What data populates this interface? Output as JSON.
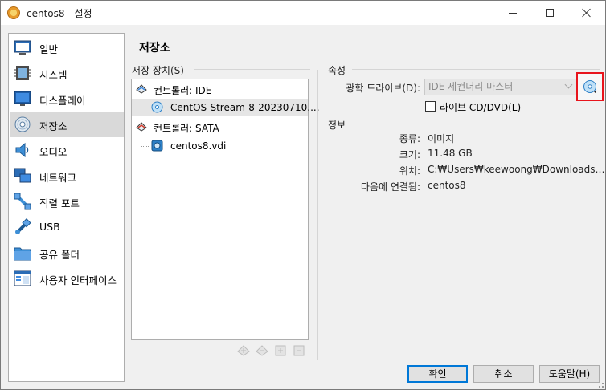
{
  "window": {
    "title": "centos8 - 설정"
  },
  "sidebar": {
    "items": [
      {
        "label": "일반",
        "icon": "general-icon"
      },
      {
        "label": "시스템",
        "icon": "system-icon"
      },
      {
        "label": "디스플레이",
        "icon": "display-icon"
      },
      {
        "label": "저장소",
        "icon": "storage-icon",
        "selected": true
      },
      {
        "label": "오디오",
        "icon": "audio-icon"
      },
      {
        "label": "네트워크",
        "icon": "network-icon"
      },
      {
        "label": "직렬 포트",
        "icon": "serial-port-icon"
      },
      {
        "label": "USB",
        "icon": "usb-icon"
      },
      {
        "label": "공유 폴더",
        "icon": "shared-folder-icon"
      },
      {
        "label": "사용자 인터페이스",
        "icon": "user-interface-icon"
      }
    ]
  },
  "page": {
    "title": "저장소"
  },
  "storage": {
    "group_label": "저장 장치(S)",
    "tree": [
      {
        "label": "컨트롤러: IDE",
        "type": "controller"
      },
      {
        "label": "CentOS-Stream-8-20230710....",
        "type": "optical",
        "selected": true
      },
      {
        "label": "컨트롤러: SATA",
        "type": "controller"
      },
      {
        "label": "centos8.vdi",
        "type": "disk"
      }
    ]
  },
  "attributes": {
    "group_label": "속성",
    "optical_drive_label": "광학 드라이브(D):",
    "optical_drive_value": "IDE 세컨더리 마스터",
    "live_cd_label": "라이브 CD/DVD(L)",
    "live_cd_checked": false
  },
  "info": {
    "group_label": "정보",
    "rows": [
      {
        "label": "종류:",
        "value": "이미지"
      },
      {
        "label": "크기:",
        "value": "11.48 GB"
      },
      {
        "label": "위치:",
        "value": "C:₩Users₩keewoong₩Downloads…"
      },
      {
        "label": "다음에 연결됨:",
        "value": "centos8"
      }
    ]
  },
  "footer": {
    "ok": "확인",
    "cancel": "취소",
    "help": "도움말(H)"
  },
  "colors": {
    "highlight_border": "#e8141c",
    "default_button_border": "#0078d7",
    "selection": "#d9d9d9"
  }
}
